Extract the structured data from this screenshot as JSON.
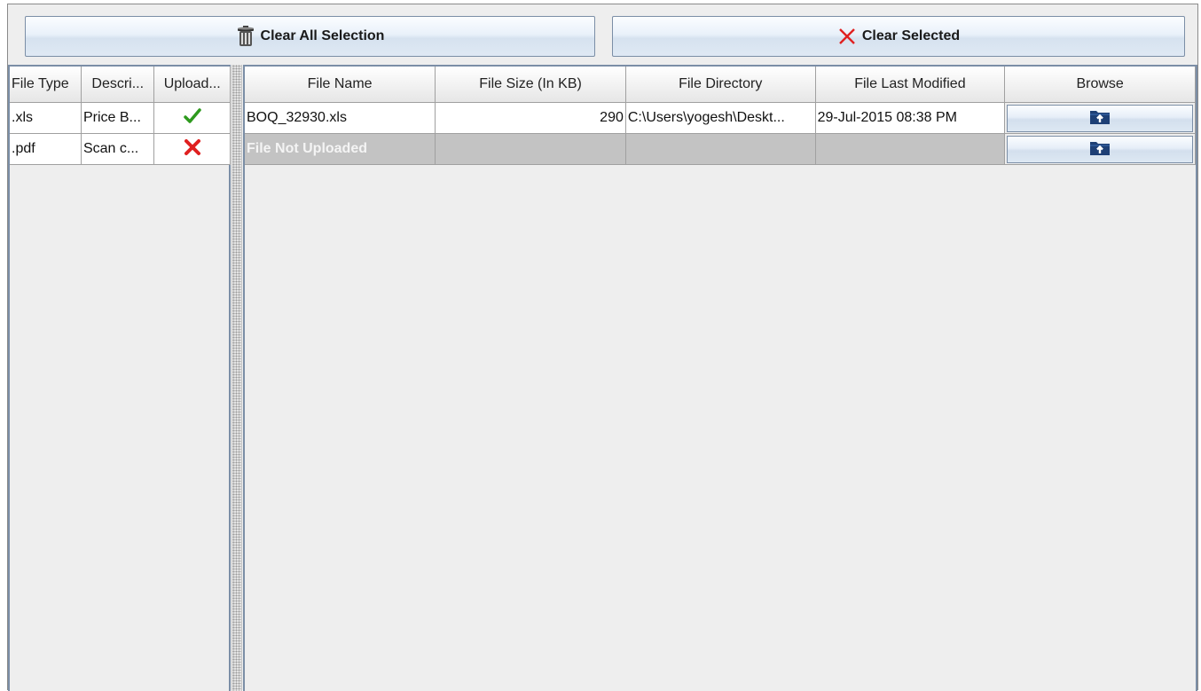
{
  "toolbar": {
    "clear_all_label": "Clear All Selection",
    "clear_all_icon": "trash-bin-icon",
    "clear_selected_label": "Clear Selected",
    "clear_selected_icon": "red-x-icon"
  },
  "left_table": {
    "headers": [
      "File Type",
      "Descri...",
      "Upload..."
    ],
    "rows": [
      {
        "file_type": ".xls",
        "description": "Price B...",
        "uploaded_icon": "green-check-icon"
      },
      {
        "file_type": ".pdf",
        "description": "Scan c...",
        "uploaded_icon": "red-x-icon"
      }
    ]
  },
  "right_table": {
    "headers": [
      "File Name",
      "File Size (In KB)",
      "File Directory",
      "File Last Modified",
      "Browse"
    ],
    "rows": [
      {
        "file_name": "BOQ_32930.xls",
        "file_size": "290",
        "file_directory": "C:\\Users\\yogesh\\Deskt...",
        "last_modified": "29-Jul-2015 08:38 PM",
        "browse_icon": "folder-upload-icon"
      },
      {
        "file_name": "File Not Uploaded",
        "file_size": "",
        "file_directory": "",
        "last_modified": "",
        "browse_icon": "folder-upload-icon"
      }
    ]
  },
  "colors": {
    "check_green": "#2e9a1e",
    "x_red": "#e02020",
    "folder_blue": "#1d3f75",
    "empty_row": "#c3c3c3"
  }
}
